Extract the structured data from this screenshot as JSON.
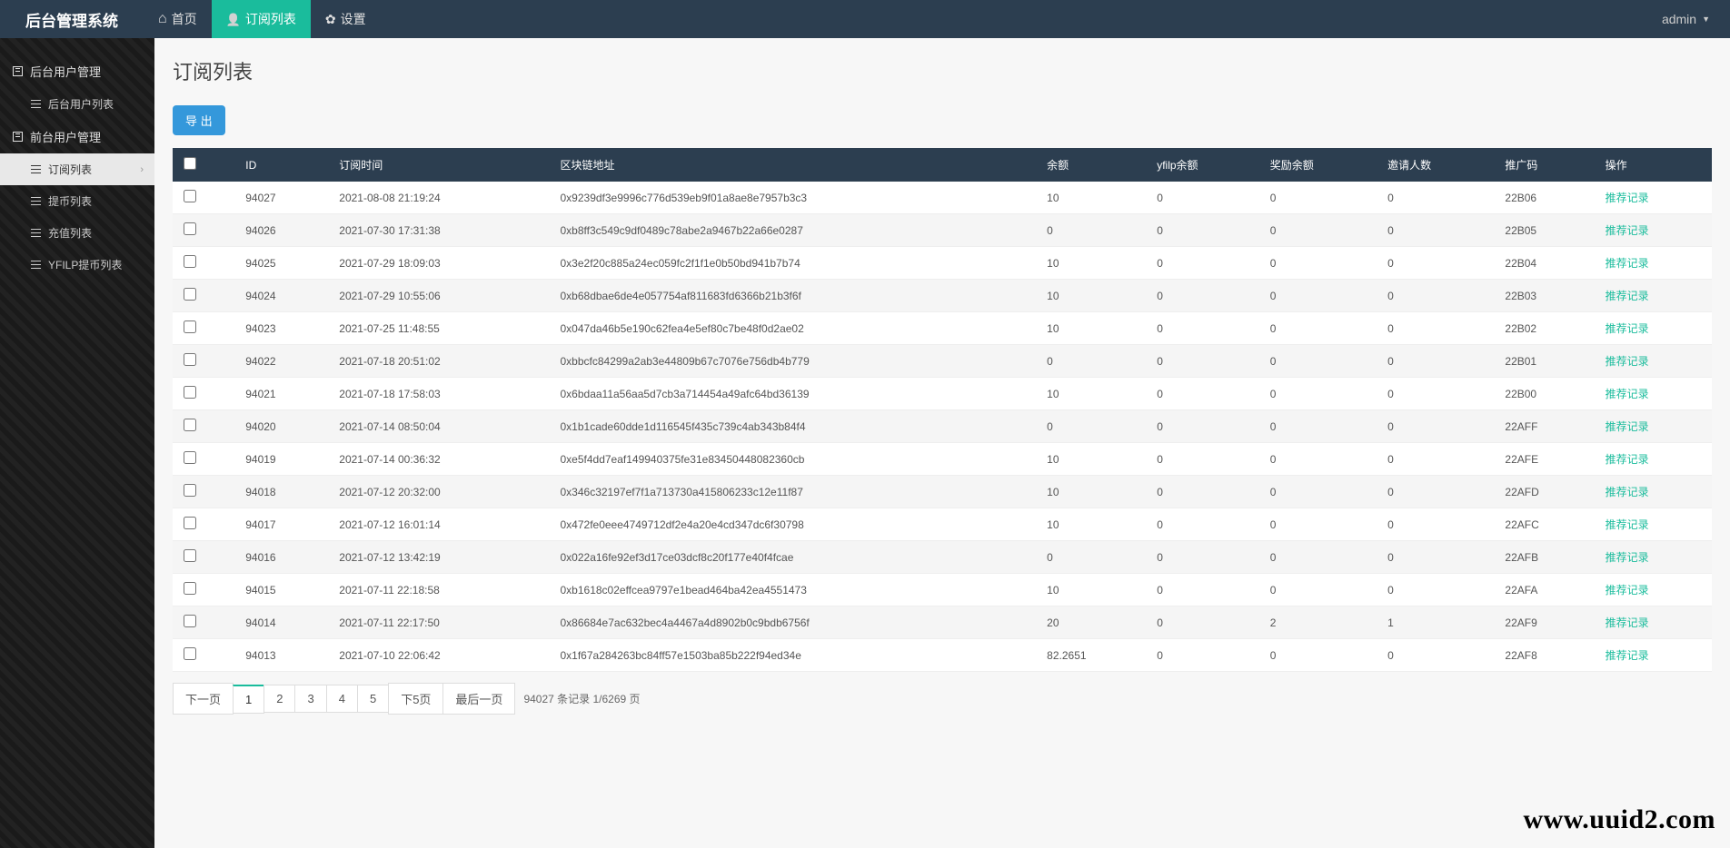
{
  "brand": "后台管理系统",
  "nav": {
    "home": "首页",
    "subscribe": "订阅列表",
    "settings": "设置"
  },
  "user": {
    "name": "admin"
  },
  "sidebar": {
    "group1": "后台用户管理",
    "item_backend_users": "后台用户列表",
    "group2": "前台用户管理",
    "item_subscribe": "订阅列表",
    "item_withdraw": "提币列表",
    "item_deposit": "充值列表",
    "item_yfilp": "YFILP提币列表"
  },
  "page": {
    "title": "订阅列表",
    "export_btn": "导 出"
  },
  "table": {
    "headers": {
      "id": "ID",
      "time": "订阅时间",
      "address": "区块链地址",
      "balance": "余额",
      "yfilp": "yfilp余额",
      "reward": "奖励余额",
      "invites": "邀请人数",
      "promo": "推广码",
      "action": "操作"
    },
    "action_label": "推荐记录",
    "rows": [
      {
        "id": "94027",
        "time": "2021-08-08 21:19:24",
        "address": "0x9239df3e9996c776d539eb9f01a8ae8e7957b3c3",
        "balance": "10",
        "yfilp": "0",
        "reward": "0",
        "invites": "0",
        "promo": "22B06"
      },
      {
        "id": "94026",
        "time": "2021-07-30 17:31:38",
        "address": "0xb8ff3c549c9df0489c78abe2a9467b22a66e0287",
        "balance": "0",
        "yfilp": "0",
        "reward": "0",
        "invites": "0",
        "promo": "22B05"
      },
      {
        "id": "94025",
        "time": "2021-07-29 18:09:03",
        "address": "0x3e2f20c885a24ec059fc2f1f1e0b50bd941b7b74",
        "balance": "10",
        "yfilp": "0",
        "reward": "0",
        "invites": "0",
        "promo": "22B04"
      },
      {
        "id": "94024",
        "time": "2021-07-29 10:55:06",
        "address": "0xb68dbae6de4e057754af811683fd6366b21b3f6f",
        "balance": "10",
        "yfilp": "0",
        "reward": "0",
        "invites": "0",
        "promo": "22B03"
      },
      {
        "id": "94023",
        "time": "2021-07-25 11:48:55",
        "address": "0x047da46b5e190c62fea4e5ef80c7be48f0d2ae02",
        "balance": "10",
        "yfilp": "0",
        "reward": "0",
        "invites": "0",
        "promo": "22B02"
      },
      {
        "id": "94022",
        "time": "2021-07-18 20:51:02",
        "address": "0xbbcfc84299a2ab3e44809b67c7076e756db4b779",
        "balance": "0",
        "yfilp": "0",
        "reward": "0",
        "invites": "0",
        "promo": "22B01"
      },
      {
        "id": "94021",
        "time": "2021-07-18 17:58:03",
        "address": "0x6bdaa11a56aa5d7cb3a714454a49afc64bd36139",
        "balance": "10",
        "yfilp": "0",
        "reward": "0",
        "invites": "0",
        "promo": "22B00"
      },
      {
        "id": "94020",
        "time": "2021-07-14 08:50:04",
        "address": "0x1b1cade60dde1d116545f435c739c4ab343b84f4",
        "balance": "0",
        "yfilp": "0",
        "reward": "0",
        "invites": "0",
        "promo": "22AFF"
      },
      {
        "id": "94019",
        "time": "2021-07-14 00:36:32",
        "address": "0xe5f4dd7eaf149940375fe31e83450448082360cb",
        "balance": "10",
        "yfilp": "0",
        "reward": "0",
        "invites": "0",
        "promo": "22AFE"
      },
      {
        "id": "94018",
        "time": "2021-07-12 20:32:00",
        "address": "0x346c32197ef7f1a713730a415806233c12e11f87",
        "balance": "10",
        "yfilp": "0",
        "reward": "0",
        "invites": "0",
        "promo": "22AFD"
      },
      {
        "id": "94017",
        "time": "2021-07-12 16:01:14",
        "address": "0x472fe0eee4749712df2e4a20e4cd347dc6f30798",
        "balance": "10",
        "yfilp": "0",
        "reward": "0",
        "invites": "0",
        "promo": "22AFC"
      },
      {
        "id": "94016",
        "time": "2021-07-12 13:42:19",
        "address": "0x022a16fe92ef3d17ce03dcf8c20f177e40f4fcae",
        "balance": "0",
        "yfilp": "0",
        "reward": "0",
        "invites": "0",
        "promo": "22AFB"
      },
      {
        "id": "94015",
        "time": "2021-07-11 22:18:58",
        "address": "0xb1618c02effcea9797e1bead464ba42ea4551473",
        "balance": "10",
        "yfilp": "0",
        "reward": "0",
        "invites": "0",
        "promo": "22AFA"
      },
      {
        "id": "94014",
        "time": "2021-07-11 22:17:50",
        "address": "0x86684e7ac632bec4a4467a4d8902b0c9bdb6756f",
        "balance": "20",
        "yfilp": "0",
        "reward": "2",
        "invites": "1",
        "promo": "22AF9"
      },
      {
        "id": "94013",
        "time": "2021-07-10 22:06:42",
        "address": "0x1f67a284263bc84ff57e1503ba85b222f94ed34e",
        "balance": "82.2651",
        "yfilp": "0",
        "reward": "0",
        "invites": "0",
        "promo": "22AF8"
      }
    ]
  },
  "pagination": {
    "prev": "下一页",
    "p1": "1",
    "p2": "2",
    "p3": "3",
    "p4": "4",
    "p5": "5",
    "next5": "下5页",
    "last": "最后一页",
    "info": "94027 条记录 1/6269 页"
  },
  "watermark": "www.uuid2.com"
}
